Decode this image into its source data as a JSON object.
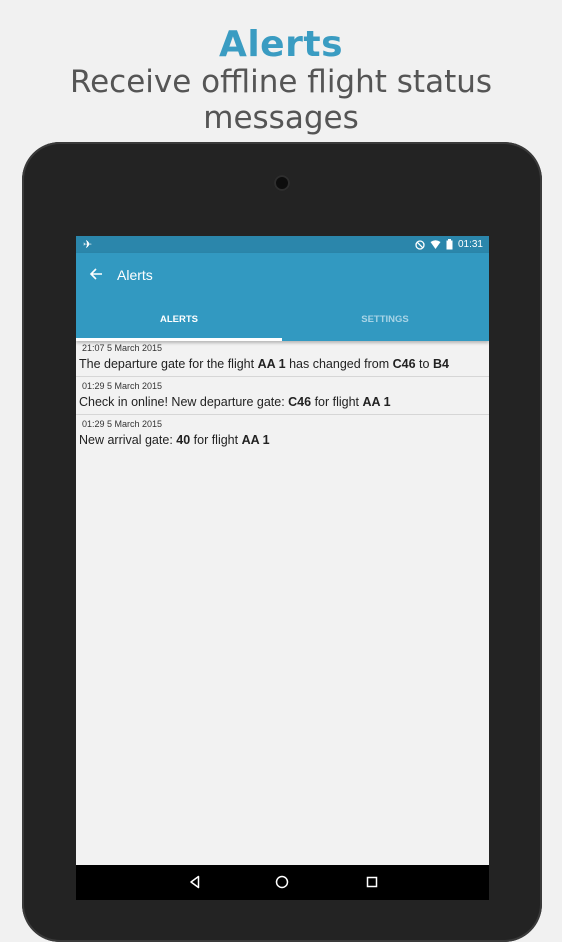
{
  "promo": {
    "title": "Alerts",
    "subtitle": "Receive offline flight status messages"
  },
  "statusbar": {
    "time": "01:31",
    "icons": [
      "airplane-mode-icon",
      "do-not-disturb-icon",
      "wifi-icon",
      "battery-icon"
    ]
  },
  "appbar": {
    "title": "Alerts",
    "back_icon": "arrow-left-icon"
  },
  "tabs": [
    {
      "label": "ALERTS",
      "selected": true
    },
    {
      "label": "SETTINGS",
      "selected": false
    }
  ],
  "alerts": [
    {
      "time": "21:07 5 March 2015",
      "message_parts": [
        {
          "text": "The departure gate for the flight ",
          "bold": false
        },
        {
          "text": "AA 1",
          "bold": true
        },
        {
          "text": " has changed from ",
          "bold": false
        },
        {
          "text": "C46",
          "bold": true
        },
        {
          "text": " to ",
          "bold": false
        },
        {
          "text": "B4",
          "bold": true
        }
      ]
    },
    {
      "time": "01:29 5 March 2015",
      "message_parts": [
        {
          "text": "Check in online! New departure gate: ",
          "bold": false
        },
        {
          "text": "C46",
          "bold": true
        },
        {
          "text": " for flight ",
          "bold": false
        },
        {
          "text": "AA 1",
          "bold": true
        }
      ]
    },
    {
      "time": "01:29 5 March 2015",
      "message_parts": [
        {
          "text": "New arrival gate: ",
          "bold": false
        },
        {
          "text": "40",
          "bold": true
        },
        {
          "text": " for flight ",
          "bold": false
        },
        {
          "text": "AA 1",
          "bold": true
        }
      ]
    }
  ],
  "colors": {
    "accent": "#3a9cc2",
    "appbar": "#3299c1",
    "statusbar": "#2b86ab"
  }
}
